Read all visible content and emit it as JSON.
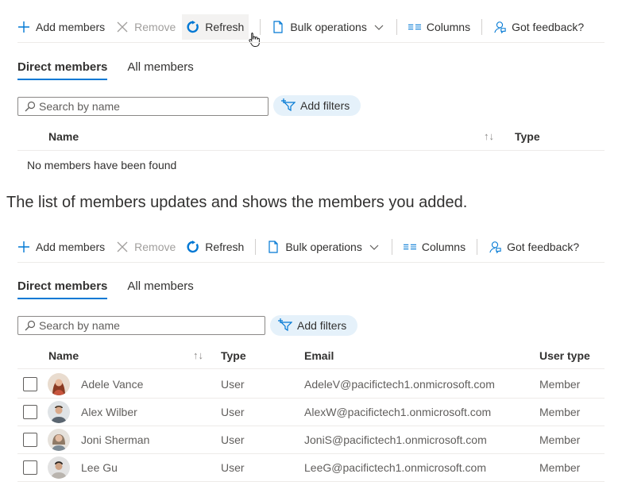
{
  "toolbar": {
    "add_members": "Add members",
    "remove": "Remove",
    "refresh": "Refresh",
    "bulk_operations": "Bulk operations",
    "columns": "Columns",
    "feedback": "Got feedback?"
  },
  "tabs": [
    "Direct members",
    "All members"
  ],
  "search": {
    "placeholder": "Search by name"
  },
  "filters": {
    "label": "Add filters"
  },
  "panel1": {
    "columns": {
      "name": "Name",
      "type": "Type"
    },
    "empty_message": "No members have been found"
  },
  "caption": "The list of members updates and shows the members you added.",
  "panel2": {
    "columns": {
      "name": "Name",
      "type": "Type",
      "email": "Email",
      "user_type": "User type"
    },
    "rows": [
      {
        "name": "Adele Vance",
        "type": "User",
        "email": "AdeleV@pacifictech1.onmicrosoft.com",
        "user_type": "Member"
      },
      {
        "name": "Alex Wilber",
        "type": "User",
        "email": "AlexW@pacifictech1.onmicrosoft.com",
        "user_type": "Member"
      },
      {
        "name": "Joni Sherman",
        "type": "User",
        "email": "JoniS@pacifictech1.onmicrosoft.com",
        "user_type": "Member"
      },
      {
        "name": "Lee Gu",
        "type": "User",
        "email": "LeeG@pacifictech1.onmicrosoft.com",
        "user_type": "Member"
      }
    ]
  },
  "colors": {
    "accent": "#0078d4",
    "filter_bg": "#e5f1fa",
    "text": "#323130",
    "muted": "#605e5c"
  }
}
